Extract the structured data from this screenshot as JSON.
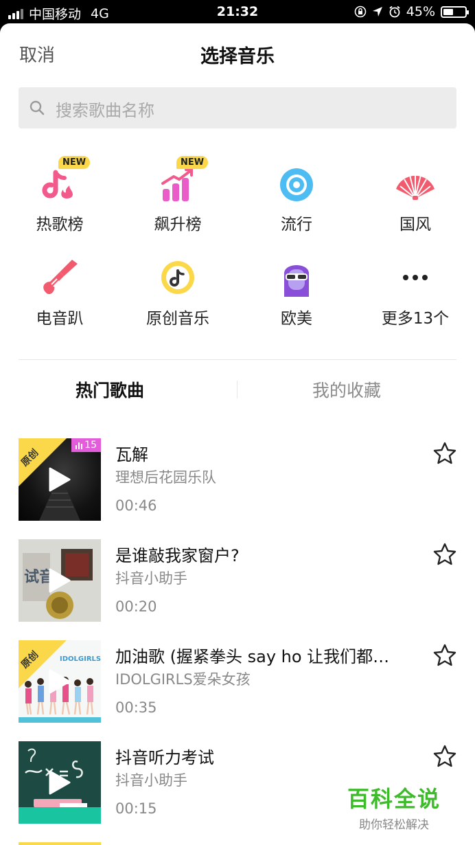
{
  "status_bar": {
    "carrier": "中国移动",
    "network": "4G",
    "time": "21:32",
    "battery": "45%",
    "battery_level": 0.45
  },
  "header": {
    "cancel_label": "取消",
    "title": "选择音乐"
  },
  "search": {
    "placeholder": "搜索歌曲名称",
    "icon": "search-icon"
  },
  "categories": [
    {
      "label": "热歌榜",
      "icon": "hot-songs-icon",
      "badge": "NEW"
    },
    {
      "label": "飙升榜",
      "icon": "rising-chart-icon",
      "badge": "NEW"
    },
    {
      "label": "流行",
      "icon": "pop-disc-icon"
    },
    {
      "label": "国风",
      "icon": "folding-fan-icon"
    },
    {
      "label": "电音趴",
      "icon": "electric-guitar-icon"
    },
    {
      "label": "原创音乐",
      "icon": "original-music-icon"
    },
    {
      "label": "欧美",
      "icon": "western-avatar-icon"
    },
    {
      "label": "更多13个",
      "icon": "more-icon"
    }
  ],
  "tabs": [
    {
      "label": "热门歌曲",
      "active": true
    },
    {
      "label": "我的收藏",
      "active": false
    }
  ],
  "songs": [
    {
      "title": "瓦解",
      "artist": "理想后花园乐队",
      "duration": "00:46",
      "original_tag": "原创",
      "rank": "15"
    },
    {
      "title": "是谁敲我家窗户?",
      "artist": "抖音小助手",
      "duration": "00:20"
    },
    {
      "title": "加油歌 (握紧拳头 say ho 让我们都…",
      "artist": "IDOLGIRLS爱朵女孩",
      "duration": "00:35",
      "original_tag": "原创"
    },
    {
      "title": "抖音听力考试",
      "artist": "抖音小助手",
      "duration": "00:15"
    }
  ],
  "watermark": {
    "main": "百科全说",
    "sub": "助你轻松解决"
  },
  "colors": {
    "accent_pink": "#f25a8b",
    "badge_yellow": "#fbd84a",
    "rank_magenta": "#e35ddb",
    "watermark_green": "#3dbb2a"
  }
}
